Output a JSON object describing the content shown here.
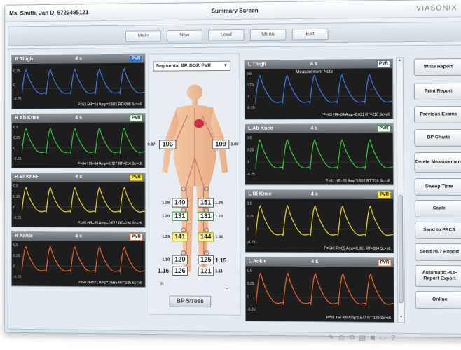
{
  "header": {
    "patient": "Ms. Smith, Jan D.  5722485121",
    "title": "Summary Screen",
    "brand": "VIASONIX"
  },
  "nav": {
    "main": "Main",
    "new": "New",
    "load": "Load",
    "menu": "Menu",
    "exit": "Exit"
  },
  "panels": {
    "r_thigh": {
      "label": "R Thigh",
      "time": "4 s",
      "badge": "PVR",
      "color": "#3f78e0",
      "stats": "P=63   HR=64   Amp=0.581   RT=208   Sc=x6",
      "yticks": [
        "0.25",
        "0",
        "-0.25"
      ]
    },
    "r_abknee": {
      "label": "R Ab Knee",
      "time": "4 s",
      "badge": "PVR",
      "color": "#36c43f",
      "stats": "P=64   HR=64   Amp=0.727   RT=214   Sc=x6",
      "yticks": [
        "0.5",
        "0.25",
        "0",
        "-0.25"
      ]
    },
    "r_biknee": {
      "label": "R Bl Knee",
      "time": "4 s",
      "badge": "PVR",
      "color": "#e6d72e",
      "stats": "P=65   HR=65   Amp=0.872   RT=234   Sc=x6",
      "yticks": [
        "0.5",
        "0.25",
        "0",
        "-0.25"
      ]
    },
    "r_ankle": {
      "label": "R Ankle",
      "time": "4 s",
      "badge": "PVR",
      "color": "#e8682a",
      "stats": "P=60   HR=71   Amp=0.585   RT=236   Sc=x6",
      "yticks": [
        "0.5",
        "0.25",
        "0",
        "-0.25"
      ]
    },
    "l_thigh": {
      "label": "L Thigh",
      "time": "4 s",
      "badge": "PVR",
      "color": "#3f78e0",
      "note": "Measurement Note",
      "stats": "P=63   HR=64   Amp=0.631   RT=210   Sc=x6",
      "yticks": [
        "0.5",
        "0.25",
        "0",
        "-0.25"
      ]
    },
    "l_abknee": {
      "label": "L Ab Knee",
      "time": "4 s",
      "badge": "PVR",
      "color": "#36c43f",
      "stats": "P=61   HR–65   Amp“0.952   RT“216   Sc=x6",
      "yticks": [
        "0.5",
        "0.25",
        "0",
        "-0.25"
      ]
    },
    "l_biknee": {
      "label": "L Bl Knee",
      "time": "4 s",
      "badge": "PVR",
      "color": "#e6d72e",
      "stats": "P=64   HR=65   Amp=0.861   RT=204   Sc=x6",
      "yticks": [
        "0.5",
        "0.25",
        "0",
        "-0.25"
      ]
    },
    "l_ankle": {
      "label": "L Ankle",
      "time": "4 s",
      "badge": "PVR",
      "color": "#e8682a",
      "stats": "P=61   HR–69   Amp“0.577   RT“189   Sc=x6",
      "yticks": [
        "0.5",
        "0.25",
        "0",
        "-0.25"
      ]
    }
  },
  "center": {
    "select": "Segmental BP, DOP, PVR",
    "brachial_left": {
      "ratio": "0.97",
      "value": "106"
    },
    "brachial_right": {
      "ratio": "1.00",
      "value": "109"
    },
    "rows": [
      {
        "r_ratio": "1.28",
        "r_value": "140",
        "l_value": "151",
        "l_ratio": "1.38"
      },
      {
        "r_ratio": "1.20",
        "r_value": "131",
        "l_value": "131",
        "l_ratio": "1.20"
      },
      {
        "r_ratio": "1.29",
        "r_value": "141",
        "l_value": "144",
        "l_ratio": "1.32"
      },
      {
        "r_ratio": "1.10",
        "r_value": "120",
        "l_value": "125",
        "l_ratio": "1.15"
      },
      {
        "r_ratio": "1.16",
        "r_value": "126",
        "l_value": "121",
        "l_ratio": "1.11"
      }
    ],
    "r": "R",
    "l": "L",
    "stress_button": "BP Stress"
  },
  "sidebar": {
    "write_report": "Write Report",
    "print_report": "Print Report",
    "previous_exams": "Previous Exams",
    "bp_charts": "BP Charts",
    "delete_measurement": "Delete Measurement",
    "sweep_time": "Sweep Time",
    "scale": "Scale",
    "send_pacs": "Send to PACS",
    "send_hl7": "Send HL7 Report",
    "auto_pdf": "Automatic PDF Report Export",
    "online": "Online"
  },
  "colors": {
    "background": "#e3eaf0",
    "panel": "#1d1d1d"
  },
  "footer_icons": [
    "wrench-icon",
    "printer-icon",
    "gear-icon",
    "file-icon",
    "camera-icon",
    "monitor-icon",
    "help-icon"
  ]
}
